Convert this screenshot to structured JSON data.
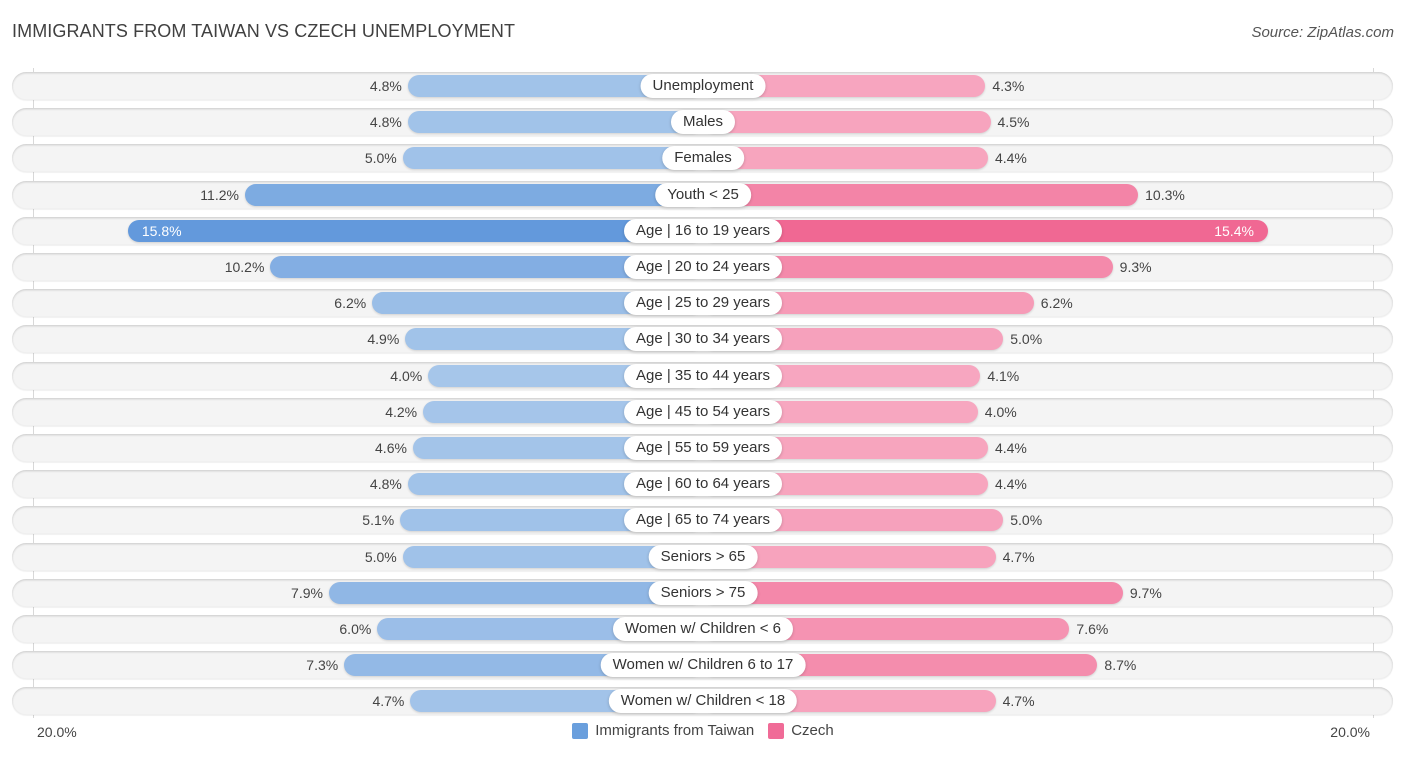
{
  "title": "IMMIGRANTS FROM TAIWAN VS CZECH UNEMPLOYMENT",
  "source": "Source: ZipAtlas.com",
  "colors": {
    "left_light": "#a6c6ea",
    "left_strong": "#6399dc",
    "right_light": "#f7a7c0",
    "right_strong": "#f06893",
    "legend_left": "#6a9fdd",
    "legend_right": "#f06b97"
  },
  "legend": {
    "left_label": "Immigrants from Taiwan",
    "right_label": "Czech"
  },
  "axis": {
    "left_max_label": "20.0%",
    "right_max_label": "20.0%"
  },
  "chart_data": {
    "type": "bar",
    "orientation": "horizontal-diverging",
    "title": "IMMIGRANTS FROM TAIWAN VS CZECH UNEMPLOYMENT",
    "xlabel": "",
    "ylabel": "",
    "xlim": [
      0,
      20
    ],
    "unit": "%",
    "legend_position": "bottom-center",
    "grid": false,
    "categories": [
      "Unemployment",
      "Males",
      "Females",
      "Youth < 25",
      "Age | 16 to 19 years",
      "Age | 20 to 24 years",
      "Age | 25 to 29 years",
      "Age | 30 to 34 years",
      "Age | 35 to 44 years",
      "Age | 45 to 54 years",
      "Age | 55 to 59 years",
      "Age | 60 to 64 years",
      "Age | 65 to 74 years",
      "Seniors > 65",
      "Seniors > 75",
      "Women w/ Children < 6",
      "Women w/ Children 6 to 17",
      "Women w/ Children < 18"
    ],
    "series": [
      {
        "name": "Immigrants from Taiwan",
        "side": "left",
        "values": [
          4.8,
          4.8,
          5.0,
          11.2,
          15.8,
          10.2,
          6.2,
          4.9,
          4.0,
          4.2,
          4.6,
          4.8,
          5.1,
          5.0,
          7.9,
          6.0,
          7.3,
          4.7
        ],
        "labels": [
          "4.8%",
          "4.8%",
          "5.0%",
          "11.2%",
          "15.8%",
          "10.2%",
          "6.2%",
          "4.9%",
          "4.0%",
          "4.2%",
          "4.6%",
          "4.8%",
          "5.1%",
          "5.0%",
          "7.9%",
          "6.0%",
          "7.3%",
          "4.7%"
        ]
      },
      {
        "name": "Czech",
        "side": "right",
        "values": [
          4.3,
          4.5,
          4.4,
          10.3,
          15.4,
          9.3,
          6.2,
          5.0,
          4.1,
          4.0,
          4.4,
          4.4,
          5.0,
          4.7,
          9.7,
          7.6,
          8.7,
          4.7
        ],
        "labels": [
          "4.3%",
          "4.5%",
          "4.4%",
          "10.3%",
          "15.4%",
          "9.3%",
          "6.2%",
          "5.0%",
          "4.1%",
          "4.0%",
          "4.4%",
          "4.4%",
          "5.0%",
          "4.7%",
          "9.7%",
          "7.6%",
          "8.7%",
          "4.7%"
        ]
      }
    ]
  }
}
